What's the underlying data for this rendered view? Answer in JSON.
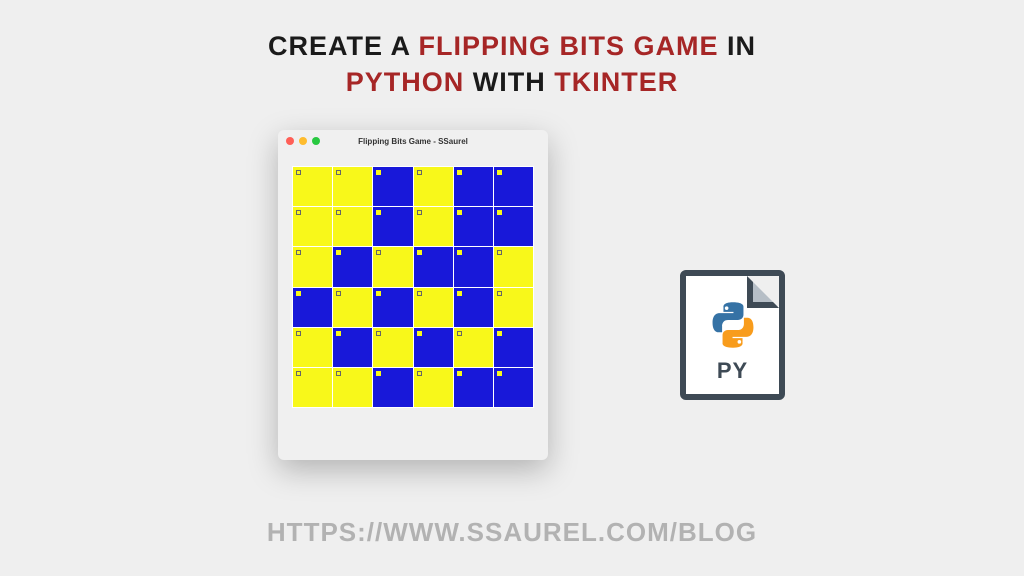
{
  "title": {
    "seg1": "CREATE A ",
    "seg2": "FLIPPING BITS GAME",
    "seg3": " IN",
    "seg4": "PYTHON",
    "seg5": " WITH ",
    "seg6": "TKINTER"
  },
  "window": {
    "title": "Flipping Bits Game - SSaurel"
  },
  "grid": {
    "rows": [
      [
        "y",
        "y",
        "b",
        "y",
        "b",
        "b"
      ],
      [
        "y",
        "y",
        "b",
        "y",
        "b",
        "b"
      ],
      [
        "y",
        "b",
        "y",
        "b",
        "b",
        "y"
      ],
      [
        "b",
        "y",
        "b",
        "y",
        "b",
        "y"
      ],
      [
        "y",
        "b",
        "y",
        "b",
        "y",
        "b"
      ],
      [
        "y",
        "y",
        "b",
        "y",
        "b",
        "b"
      ]
    ]
  },
  "pyfile": {
    "label": "PY"
  },
  "footer": {
    "url": "HTTPS://WWW.SSAUREL.COM/BLOG"
  },
  "colors": {
    "accent_red": "#a62626",
    "yellow": "#f8f81a",
    "blue": "#1818d9",
    "slate": "#3e4a55"
  }
}
